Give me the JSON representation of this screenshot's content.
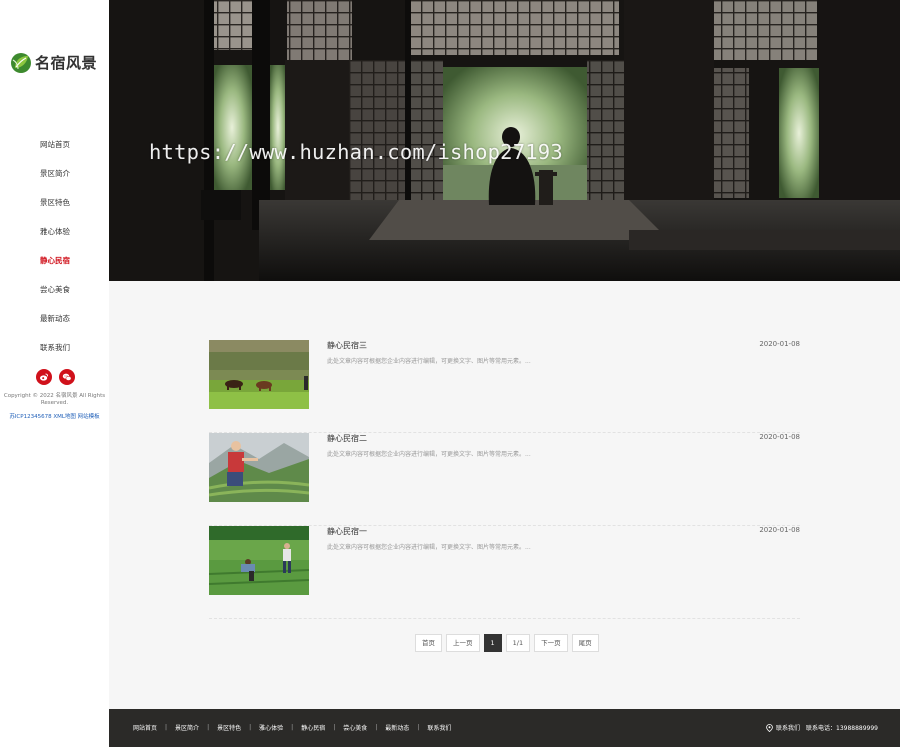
{
  "brand": {
    "name": "名宿风景"
  },
  "nav": [
    {
      "label": "网站首页",
      "active": false
    },
    {
      "label": "景区简介",
      "active": false
    },
    {
      "label": "景区特色",
      "active": false
    },
    {
      "label": "雅心体验",
      "active": false
    },
    {
      "label": "静心民宿",
      "active": true
    },
    {
      "label": "尝心美食",
      "active": false
    },
    {
      "label": "最新动态",
      "active": false
    },
    {
      "label": "联系我们",
      "active": false
    }
  ],
  "social": {
    "weibo": "weibo-icon",
    "wechat": "wechat-icon"
  },
  "copyright": "Copyright © 2022 名宿风景 All Rights Reserved.",
  "icp": {
    "beian": "苏ICP12345678",
    "xml": "XML地图",
    "template": "网站模板"
  },
  "watermark": "https://www.huzhan.com/ishop27193",
  "articles": [
    {
      "title": "静心民宿三",
      "desc": "此处文章内容可根据您企业内容进行编辑，可更换文字、图片等常用元素。...",
      "date": "2020-01-08"
    },
    {
      "title": "静心民宿二",
      "desc": "此处文章内容可根据您企业内容进行编辑，可更换文字、图片等常用元素。...",
      "date": "2020-01-08"
    },
    {
      "title": "静心民宿一",
      "desc": "此处文章内容可根据您企业内容进行编辑，可更换文字、图片等常用元素。...",
      "date": "2020-01-08"
    }
  ],
  "pager": {
    "first": "首页",
    "prev": "上一页",
    "current": "1",
    "total": "1/1",
    "next": "下一页",
    "last": "尾页"
  },
  "footer": {
    "links": [
      "网站首页",
      "景区简介",
      "景区特色",
      "雅心体验",
      "静心民宿",
      "尝心美食",
      "最新动态",
      "联系我们"
    ],
    "address": "联系我们",
    "phone": "联系电话：13988889999"
  },
  "colors": {
    "accent": "#d0111b",
    "footer_bg": "#2b2a28",
    "link_blue": "#1f5fb8"
  }
}
